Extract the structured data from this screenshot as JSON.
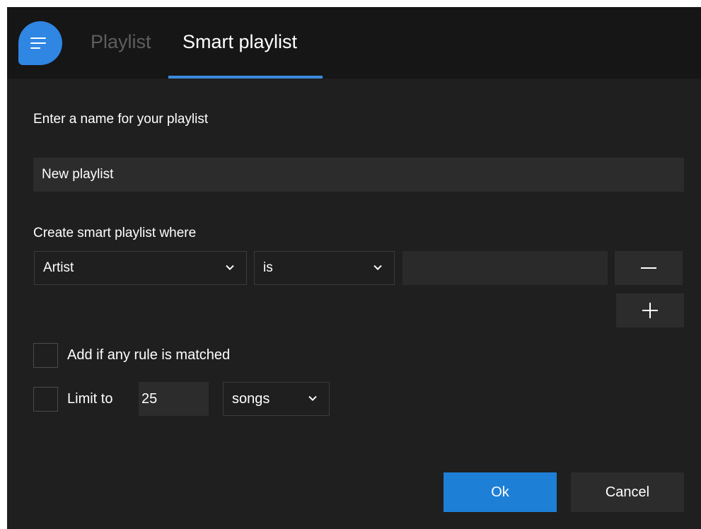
{
  "header": {
    "logo_icon": "menu-lines-icon",
    "tabs": [
      {
        "label": "Playlist",
        "active": false
      },
      {
        "label": "Smart playlist",
        "active": true
      }
    ],
    "accent_color": "#3a8bdc"
  },
  "form": {
    "name_label": "Enter a name for your playlist",
    "name_value": "New playlist",
    "rule_label": "Create smart playlist where",
    "rule": {
      "field_selected": "Artist",
      "operator_selected": "is",
      "value": ""
    },
    "remove_rule_icon": "minus-icon",
    "add_rule_icon": "plus-icon",
    "match_any_label": "Add if any rule is matched",
    "match_any_checked": false,
    "limit_label": "Limit to",
    "limit_checked": false,
    "limit_value": "25",
    "limit_unit_selected": "songs"
  },
  "footer": {
    "ok_label": "Ok",
    "cancel_label": "Cancel",
    "ok_color": "#1e7fd6"
  }
}
